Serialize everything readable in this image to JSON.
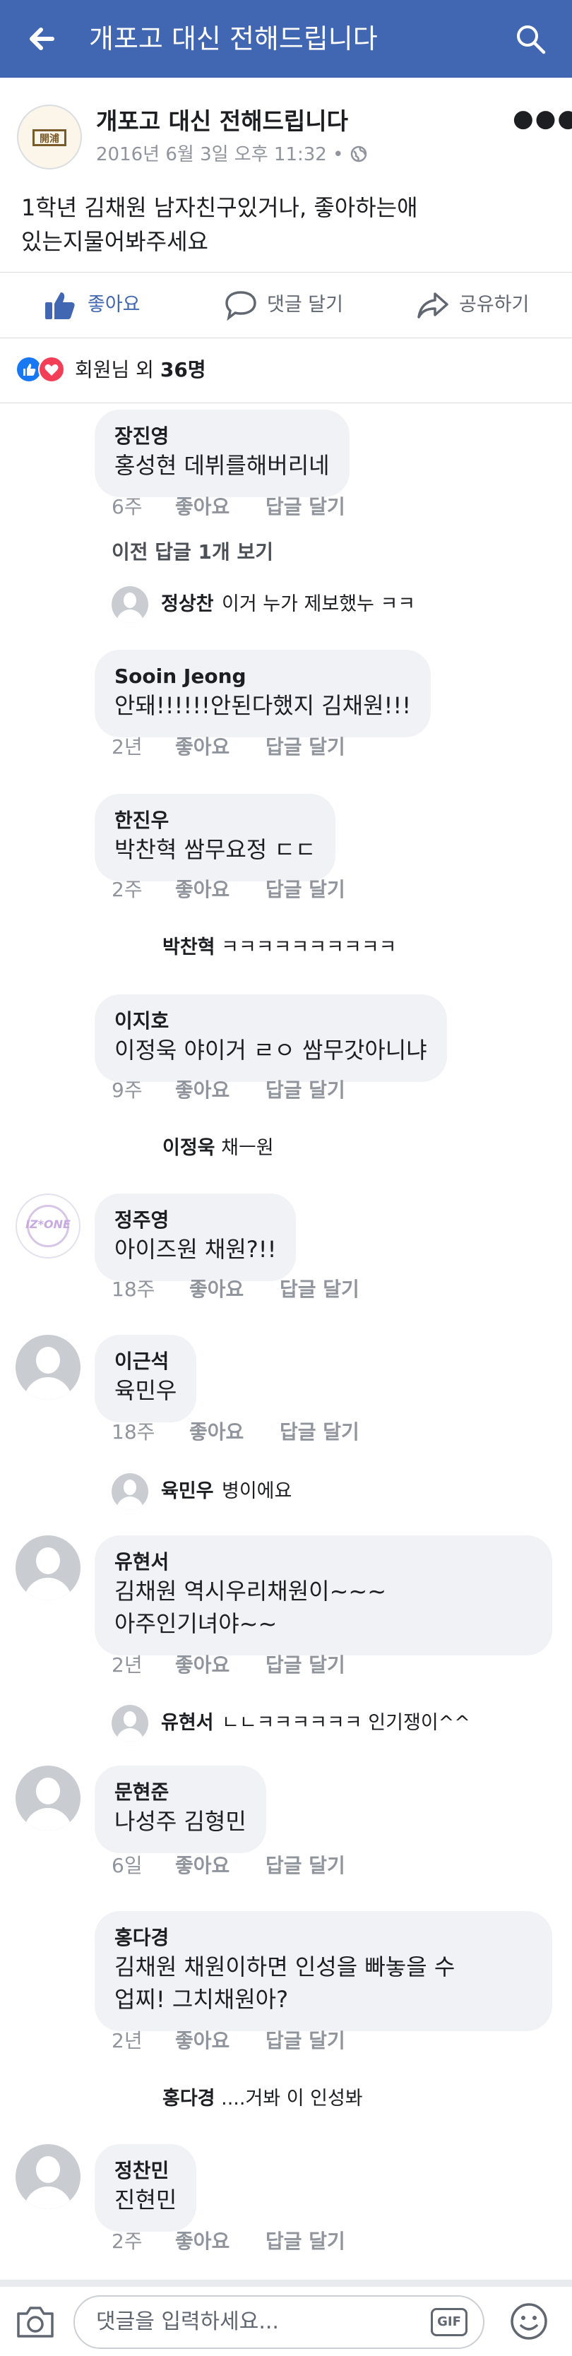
{
  "header": {
    "title": "개포고 대신 전해드립니다",
    "back_icon": "arrow-left-icon",
    "search_icon": "search-icon"
  },
  "post": {
    "page_name": "개포고 대신 전해드립니다",
    "avatar_text": "開浦",
    "time": "2016년 6월 3일 오후 11:32 • ",
    "privacy_icon": "globe-icon",
    "text_line1": "1학년 김채원 남자친구있거나, 좋아하는애",
    "text_line2": "있는지물어봐주세요"
  },
  "actions": {
    "like": "좋아요",
    "comment": "댓글 달기",
    "share": "공유하기"
  },
  "reactions": {
    "summary_prefix": "회원님 외 ",
    "summary_count": "36명"
  },
  "comment_actions": {
    "like": "좋아요",
    "reply": "답글 달기"
  },
  "comments": [
    {
      "name": "장진영",
      "text": "홍성현 데뷔를해버리네",
      "time": "6주"
    },
    {
      "prev_replies": "이전 답글 1개 보기"
    },
    {
      "reply_name": "정상찬",
      "reply_text": " 이거 누가 제보했누 ㅋㅋ"
    },
    {
      "name": "Sooin Jeong",
      "text": "안돼!!!!!!안된다했지 김채원!!!",
      "time": "2년"
    },
    {
      "name": "한진우",
      "text": "박찬혁 쌈무요정 ㄷㄷ",
      "time": "2주"
    },
    {
      "reply_name": "박찬혁",
      "reply_text": " ㅋㅋㅋㅋㅋㅋㅋㅋㅋㅋ"
    },
    {
      "name": "이지호",
      "text": "이정욱 야이거 ㄹㅇ 쌈무갓아니냐",
      "time": "9주"
    },
    {
      "reply_name": "이정욱",
      "reply_text": " 채ㅡ원"
    },
    {
      "name": "정주영",
      "text": "아이즈원 채원?!!",
      "time": "18주",
      "avatar_text": "IZ*ONE"
    },
    {
      "name": "이근석",
      "text": "육민우",
      "time": "18주"
    },
    {
      "reply_name": "육민우",
      "reply_text": " 병이에요"
    },
    {
      "name": "유현서",
      "text_line1": "김채원 역시우리채원이~~~",
      "text_line2": "아주인기녀야~~",
      "time": "2년"
    },
    {
      "reply_name": "유현서",
      "reply_text": " ㄴㄴㅋㅋㅋㅋㅋㅋ 인기쟁이^^"
    },
    {
      "name": "문현준",
      "text": "나성주 김형민",
      "time": "6일"
    },
    {
      "name": "홍다경",
      "text_line1": "김채원 채원이하면 인성을 빠놓을 수",
      "text_line2": "업찌! 그치채원아?",
      "time": "2년"
    },
    {
      "reply_name": "홍다경",
      "reply_text": " ....거봐 이 인성봐"
    },
    {
      "name": "정찬민",
      "text": "진현민",
      "time": "2주"
    }
  ],
  "composer": {
    "placeholder": "댓글을 입력하세요...",
    "gif_label": "GIF",
    "camera_icon": "camera-icon",
    "emoji_icon": "smile-icon"
  },
  "colors": {
    "brand": "#4267b2",
    "like_blue": "#4267b2",
    "bubble": "#f0f2f5",
    "meta_gray": "#90949c"
  }
}
